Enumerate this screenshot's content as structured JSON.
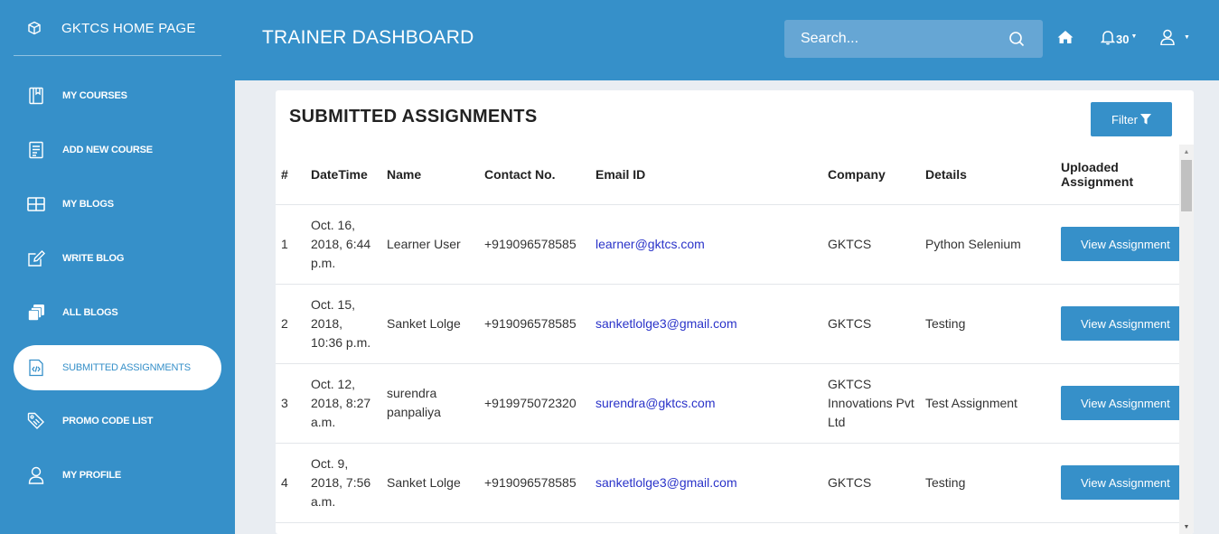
{
  "sidebar": {
    "brand": "GKTCS HOME PAGE",
    "items": [
      {
        "label": "MY COURSES",
        "icon": "book-icon"
      },
      {
        "label": "ADD NEW COURSE",
        "icon": "document-add-icon"
      },
      {
        "label": "MY BLOGS",
        "icon": "grid-icon"
      },
      {
        "label": "WRITE BLOG",
        "icon": "edit-icon"
      },
      {
        "label": "ALL BLOGS",
        "icon": "stack-icon"
      },
      {
        "label": "SUBMITTED ASSIGNMENTS",
        "icon": "code-file-icon"
      },
      {
        "label": "PROMO CODE LIST",
        "icon": "tag-icon"
      },
      {
        "label": "MY PROFILE",
        "icon": "user-icon"
      }
    ]
  },
  "header": {
    "title": "TRAINER DASHBOARD",
    "search_placeholder": "Search...",
    "notification_count": "30"
  },
  "main": {
    "title": "SUBMITTED ASSIGNMENTS",
    "filter_label": "Filter",
    "columns": [
      "#",
      "DateTime",
      "Name",
      "Contact No.",
      "Email ID",
      "Company",
      "Details",
      "Uploaded Assignment"
    ],
    "rows": [
      {
        "num": "1",
        "datetime": "Oct. 16, 2018, 6:44 p.m.",
        "name": "Learner User",
        "contact": "+919096578585",
        "email": "learner@gktcs.com",
        "company": "GKTCS",
        "details": "Python Selenium",
        "action": "View Assignment"
      },
      {
        "num": "2",
        "datetime": "Oct. 15, 2018, 10:36 p.m.",
        "name": "Sanket Lolge",
        "contact": "+919096578585",
        "email": "sanketlolge3@gmail.com",
        "company": "GKTCS",
        "details": "Testing",
        "action": "View Assignment"
      },
      {
        "num": "3",
        "datetime": "Oct. 12, 2018, 8:27 a.m.",
        "name": "surendra panpaliya",
        "contact": "+919975072320",
        "email": "surendra@gktcs.com",
        "company": "GKTCS Innovations Pvt Ltd",
        "details": "Test Assignment",
        "action": "View Assignment"
      },
      {
        "num": "4",
        "datetime": "Oct. 9, 2018, 7:56 a.m.",
        "name": "Sanket Lolge",
        "contact": "+919096578585",
        "email": "sanketlolge3@gmail.com",
        "company": "GKTCS",
        "details": "Testing",
        "action": "View Assignment"
      }
    ]
  },
  "colors": {
    "primary": "#3690c9",
    "search_bg": "#66a6d4",
    "link": "#2a33c9",
    "page_bg": "#e9edf2"
  }
}
